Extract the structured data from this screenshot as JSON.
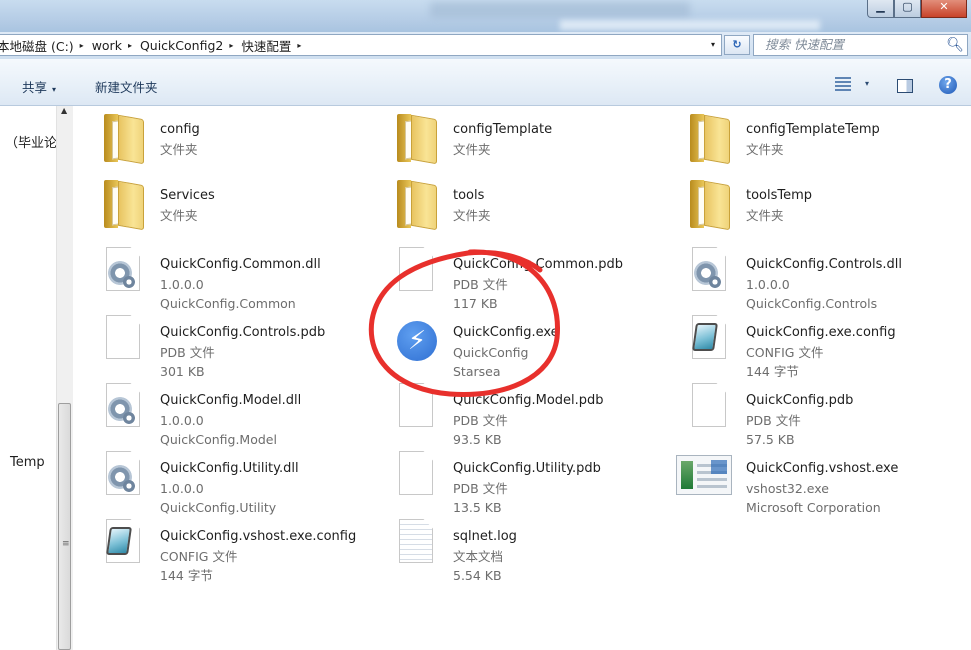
{
  "window": {
    "buttons": {
      "minimize": "▁",
      "maximize": "▢",
      "close": "✕"
    }
  },
  "address": {
    "crumbs": [
      "本地磁盘 (C:)",
      "work",
      "QuickConfig2",
      "快速配置"
    ],
    "separator": "▸",
    "dropdown": "▾",
    "refresh": "↻"
  },
  "search": {
    "placeholder": "搜索 快速配置",
    "icon": "magnifier-icon"
  },
  "toolbar": {
    "share_label": "共享",
    "share_caret": "▾",
    "new_folder_label": "新建文件夹",
    "view_caret": "▾",
    "help_label": "?"
  },
  "nav": {
    "items": [
      "（毕业论",
      "Temp"
    ]
  },
  "files": [
    {
      "name": "config",
      "line2": "文件夹",
      "line3": "",
      "icon": "folder-icon"
    },
    {
      "name": "configTemplate",
      "line2": "文件夹",
      "line3": "",
      "icon": "folder-icon"
    },
    {
      "name": "configTemplateTemp",
      "line2": "文件夹",
      "line3": "",
      "icon": "folder-icon"
    },
    {
      "name": "Services",
      "line2": "文件夹",
      "line3": "",
      "icon": "folder-icon"
    },
    {
      "name": "tools",
      "line2": "文件夹",
      "line3": "",
      "icon": "folder-icon"
    },
    {
      "name": "toolsTemp",
      "line2": "文件夹",
      "line3": "",
      "icon": "folder-icon"
    },
    {
      "name": "QuickConfig.Common.dll",
      "line2": "1.0.0.0",
      "line3": "QuickConfig.Common",
      "icon": "dll-gear-icon"
    },
    {
      "name": "QuickConfig.Common.pdb",
      "line2": "PDB 文件",
      "line3": "117 KB",
      "icon": "blank-file-icon"
    },
    {
      "name": "QuickConfig.Controls.dll",
      "line2": "1.0.0.0",
      "line3": "QuickConfig.Controls",
      "icon": "dll-gear-icon"
    },
    {
      "name": "QuickConfig.Controls.pdb",
      "line2": "PDB 文件",
      "line3": "301 KB",
      "icon": "blank-file-icon"
    },
    {
      "name": "QuickConfig.exe",
      "line2": "QuickConfig",
      "line3": "Starsea",
      "icon": "lightning-app-icon"
    },
    {
      "name": "QuickConfig.exe.config",
      "line2": "CONFIG 文件",
      "line3": "144 字节",
      "icon": "config-file-icon"
    },
    {
      "name": "QuickConfig.Model.dll",
      "line2": "1.0.0.0",
      "line3": "QuickConfig.Model",
      "icon": "dll-gear-icon"
    },
    {
      "name": "QuickConfig.Model.pdb",
      "line2": "PDB 文件",
      "line3": "93.5 KB",
      "icon": "blank-file-icon"
    },
    {
      "name": "QuickConfig.pdb",
      "line2": "PDB 文件",
      "line3": "57.5 KB",
      "icon": "blank-file-icon"
    },
    {
      "name": "QuickConfig.Utility.dll",
      "line2": "1.0.0.0",
      "line3": "QuickConfig.Utility",
      "icon": "dll-gear-icon"
    },
    {
      "name": "QuickConfig.Utility.pdb",
      "line2": "PDB 文件",
      "line3": "13.5 KB",
      "icon": "blank-file-icon"
    },
    {
      "name": "QuickConfig.vshost.exe",
      "line2": "vshost32.exe",
      "line3": "Microsoft Corporation",
      "icon": "vshost-app-icon"
    },
    {
      "name": "QuickConfig.vshost.exe.config",
      "line2": "CONFIG 文件",
      "line3": "144 字节",
      "icon": "config-file-icon"
    },
    {
      "name": "sqlnet.log",
      "line2": "文本文档",
      "line3": "5.54 KB",
      "icon": "text-file-icon"
    }
  ],
  "annotation": {
    "color": "#e8302c",
    "target": "QuickConfig.exe"
  }
}
